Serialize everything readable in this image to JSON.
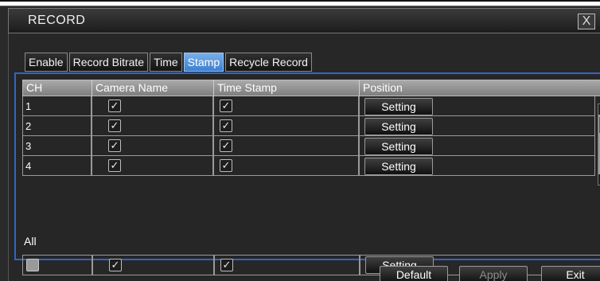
{
  "window": {
    "title": "RECORD",
    "close_glyph": "X"
  },
  "tabs": [
    {
      "label": "Enable",
      "active": false
    },
    {
      "label": "Record Bitrate",
      "active": false
    },
    {
      "label": "Time",
      "active": false
    },
    {
      "label": "Stamp",
      "active": true
    },
    {
      "label": "Recycle Record",
      "active": false
    }
  ],
  "table": {
    "columns": [
      "CH",
      "Camera Name",
      "Time Stamp",
      "Position"
    ],
    "rows": [
      {
        "ch": "1",
        "camera_name": true,
        "time_stamp": true,
        "position": "Setting"
      },
      {
        "ch": "2",
        "camera_name": true,
        "time_stamp": true,
        "position": "Setting"
      },
      {
        "ch": "3",
        "camera_name": true,
        "time_stamp": true,
        "position": "Setting"
      },
      {
        "ch": "4",
        "camera_name": true,
        "time_stamp": true,
        "position": "Setting"
      }
    ]
  },
  "all": {
    "label": "All",
    "ch": false,
    "camera_name": true,
    "time_stamp": true,
    "position": "Setting"
  },
  "footer": {
    "default_label": "Default",
    "apply_label": "Apply",
    "exit_label": "Exit"
  },
  "icons": {
    "check": "✓",
    "scroll_up": "▲",
    "scroll_down": "▼"
  },
  "colors": {
    "accent": "#3d7fcf",
    "panel_border": "#2f66c8"
  }
}
